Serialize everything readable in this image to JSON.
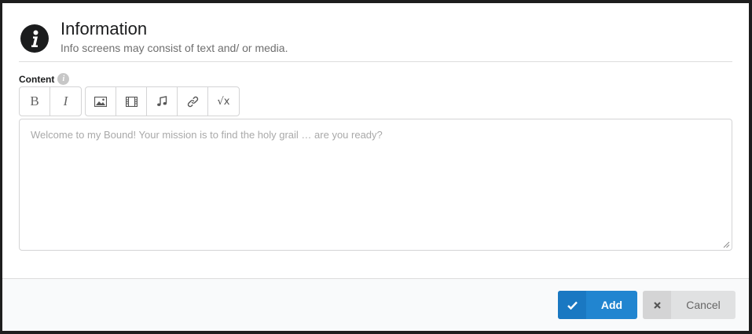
{
  "header": {
    "title": "Information",
    "subtitle": "Info screens may consist of text and/ or media.",
    "icon": "info-circle-icon"
  },
  "content_field": {
    "label": "Content",
    "help_icon": "i",
    "placeholder": "Welcome to my Bound! Your mission is to find the holy grail … are you ready?",
    "value": ""
  },
  "toolbar": {
    "bold_label": "B",
    "italic_label": "I",
    "image_icon": "image-icon",
    "video_icon": "video-icon",
    "audio_icon": "music-icon",
    "link_icon": "link-icon",
    "formula_label": "√x"
  },
  "footer": {
    "add_label": "Add",
    "cancel_label": "Cancel"
  },
  "colors": {
    "primary": "#2185d0",
    "secondary": "#e0e1e2"
  }
}
